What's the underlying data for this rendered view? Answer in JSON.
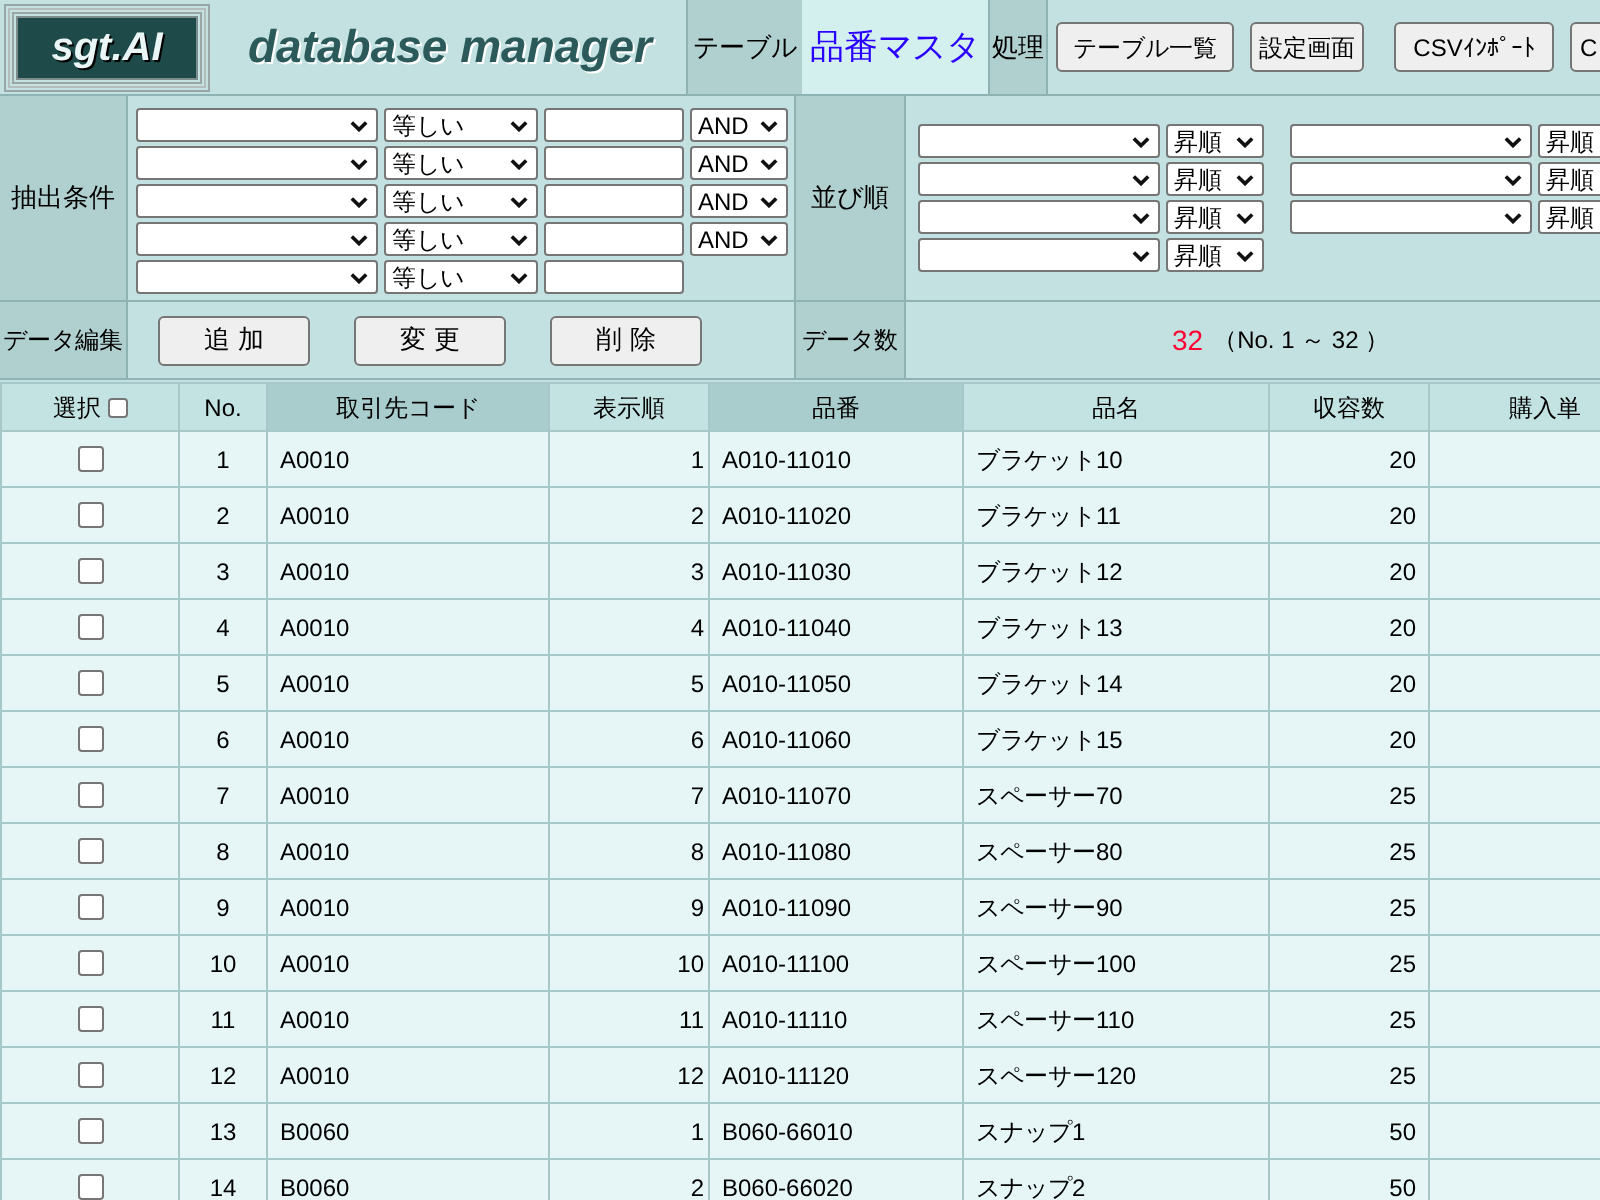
{
  "header": {
    "logo": "sgt.AI",
    "title": "database manager",
    "table_label": "テーブル",
    "table_name": "品番マスタ",
    "action_label": "処理",
    "buttons": [
      "テーブル一覧",
      "設定画面",
      "CSVｲﾝﾎﾟｰﾄ",
      "C"
    ]
  },
  "filter": {
    "label": "抽出条件",
    "rows": [
      {
        "operator": "等しい",
        "conjunction": "AND"
      },
      {
        "operator": "等しい",
        "conjunction": "AND"
      },
      {
        "operator": "等しい",
        "conjunction": "AND"
      },
      {
        "operator": "等しい",
        "conjunction": "AND"
      },
      {
        "operator": "等しい"
      }
    ]
  },
  "sort": {
    "label": "並び順",
    "groups": [
      [
        "昇順",
        "昇順",
        "昇順",
        "昇順"
      ],
      [
        "昇順",
        "昇順",
        "昇順"
      ]
    ]
  },
  "edit": {
    "label": "データ編集",
    "buttons": [
      "追 加",
      "変 更",
      "削 除"
    ]
  },
  "count": {
    "label": "データ数",
    "value": "32",
    "range": "（No. 1 ～ 32 ）"
  },
  "table": {
    "select_column": {
      "label": "選択",
      "checked": false
    },
    "columns": [
      {
        "label": "No.",
        "highlighted": false
      },
      {
        "label": "取引先コード",
        "highlighted": true
      },
      {
        "label": "表示順",
        "highlighted": false
      },
      {
        "label": "品番",
        "highlighted": true
      },
      {
        "label": "品名",
        "highlighted": false
      },
      {
        "label": "収容数",
        "highlighted": false
      },
      {
        "label": "購入単",
        "highlighted": false
      }
    ],
    "rows": [
      {
        "checked": false,
        "cells": [
          "1",
          "A0010",
          "1",
          "A010-11010",
          "ブラケット10",
          "20"
        ]
      },
      {
        "checked": false,
        "cells": [
          "2",
          "A0010",
          "2",
          "A010-11020",
          "ブラケット11",
          "20"
        ]
      },
      {
        "checked": false,
        "cells": [
          "3",
          "A0010",
          "3",
          "A010-11030",
          "ブラケット12",
          "20"
        ]
      },
      {
        "checked": false,
        "cells": [
          "4",
          "A0010",
          "4",
          "A010-11040",
          "ブラケット13",
          "20"
        ]
      },
      {
        "checked": false,
        "cells": [
          "5",
          "A0010",
          "5",
          "A010-11050",
          "ブラケット14",
          "20"
        ]
      },
      {
        "checked": false,
        "cells": [
          "6",
          "A0010",
          "6",
          "A010-11060",
          "ブラケット15",
          "20"
        ]
      },
      {
        "checked": false,
        "cells": [
          "7",
          "A0010",
          "7",
          "A010-11070",
          "スペーサー70",
          "25"
        ]
      },
      {
        "checked": false,
        "cells": [
          "8",
          "A0010",
          "8",
          "A010-11080",
          "スペーサー80",
          "25"
        ]
      },
      {
        "checked": false,
        "cells": [
          "9",
          "A0010",
          "9",
          "A010-11090",
          "スペーサー90",
          "25"
        ]
      },
      {
        "checked": false,
        "cells": [
          "10",
          "A0010",
          "10",
          "A010-11100",
          "スペーサー100",
          "25"
        ]
      },
      {
        "checked": false,
        "cells": [
          "11",
          "A0010",
          "11",
          "A010-11110",
          "スペーサー110",
          "25"
        ]
      },
      {
        "checked": false,
        "cells": [
          "12",
          "A0010",
          "12",
          "A010-11120",
          "スペーサー120",
          "25"
        ]
      },
      {
        "checked": false,
        "cells": [
          "13",
          "B0060",
          "1",
          "B060-66010",
          "スナップ1",
          "50"
        ]
      },
      {
        "checked": false,
        "cells": [
          "14",
          "B0060",
          "2",
          "B060-66020",
          "スナップ2",
          "50"
        ]
      }
    ]
  }
}
